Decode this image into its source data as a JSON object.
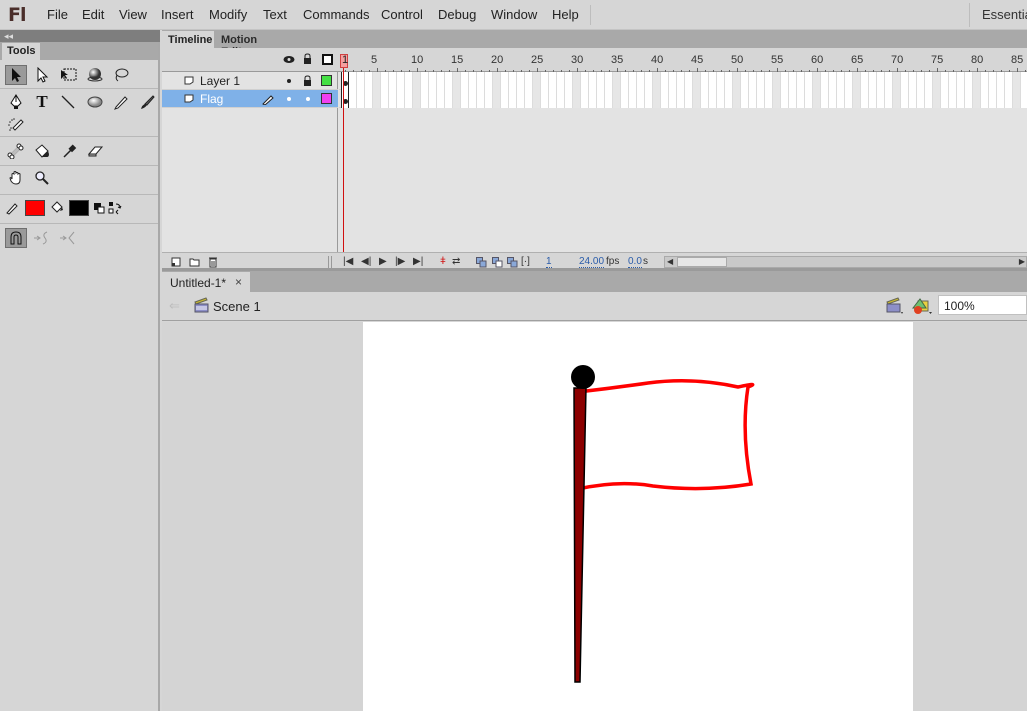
{
  "app": {
    "logo": "Fl",
    "workspace": "Essential"
  },
  "menu": [
    "File",
    "Edit",
    "View",
    "Insert",
    "Modify",
    "Text",
    "Commands",
    "Control",
    "Debug",
    "Window",
    "Help"
  ],
  "tools_panel": {
    "collapse_glyph": "◂◂",
    "tab_label": "Tools",
    "tools": [
      {
        "name": "selection-tool",
        "active": true
      },
      {
        "name": "subselection-tool"
      },
      {
        "name": "free-transform-tool"
      },
      {
        "name": "3d-rotation-tool"
      },
      {
        "name": "lasso-tool"
      },
      {
        "name": "pen-tool"
      },
      {
        "name": "text-tool",
        "glyph": "T"
      },
      {
        "name": "line-tool"
      },
      {
        "name": "oval-tool"
      },
      {
        "name": "pencil-tool"
      },
      {
        "name": "brush-tool"
      },
      {
        "name": "spray-brush-tool"
      },
      {
        "name": "bone-tool"
      },
      {
        "name": "paint-bucket-tool"
      },
      {
        "name": "eyedropper-tool"
      },
      {
        "name": "eraser-tool"
      },
      {
        "name": "hand-tool"
      },
      {
        "name": "zoom-tool"
      }
    ],
    "stroke_color": "#ff0000",
    "fill_color": "#000000",
    "snap_to_objects_active": true
  },
  "timeline": {
    "tabs": [
      {
        "label": "Timeline",
        "active": true
      },
      {
        "label": "Motion Editor",
        "active": false
      }
    ],
    "ruler_labels": [
      "1",
      "5",
      "10",
      "15",
      "20",
      "25",
      "30",
      "35",
      "40",
      "45",
      "50",
      "55",
      "60",
      "65",
      "70",
      "75",
      "80",
      "85"
    ],
    "current_frame_label": "1",
    "layers": [
      {
        "name": "Layer 1",
        "selected": false,
        "visible": true,
        "locked": true,
        "outline_color": "#44e044"
      },
      {
        "name": "Flag",
        "selected": true,
        "visible": true,
        "locked": false,
        "editing": true,
        "outline_color": "#f040f0"
      }
    ],
    "status": {
      "current_frame": "1",
      "fps": "24.00",
      "fps_unit": "fps",
      "elapsed": "0.0",
      "elapsed_unit": "s"
    }
  },
  "document": {
    "tab_title": "Untitled-1*",
    "close_glyph": "×",
    "back_glyph": "⇐",
    "scene": "Scene 1",
    "zoom": "100%"
  },
  "colors": {
    "flag_outline": "#ff0000",
    "pole_fill": "#8b0000",
    "pole_stroke": "#000000",
    "selected_layer": "#7fb1e8",
    "playhead": "#d01010"
  }
}
